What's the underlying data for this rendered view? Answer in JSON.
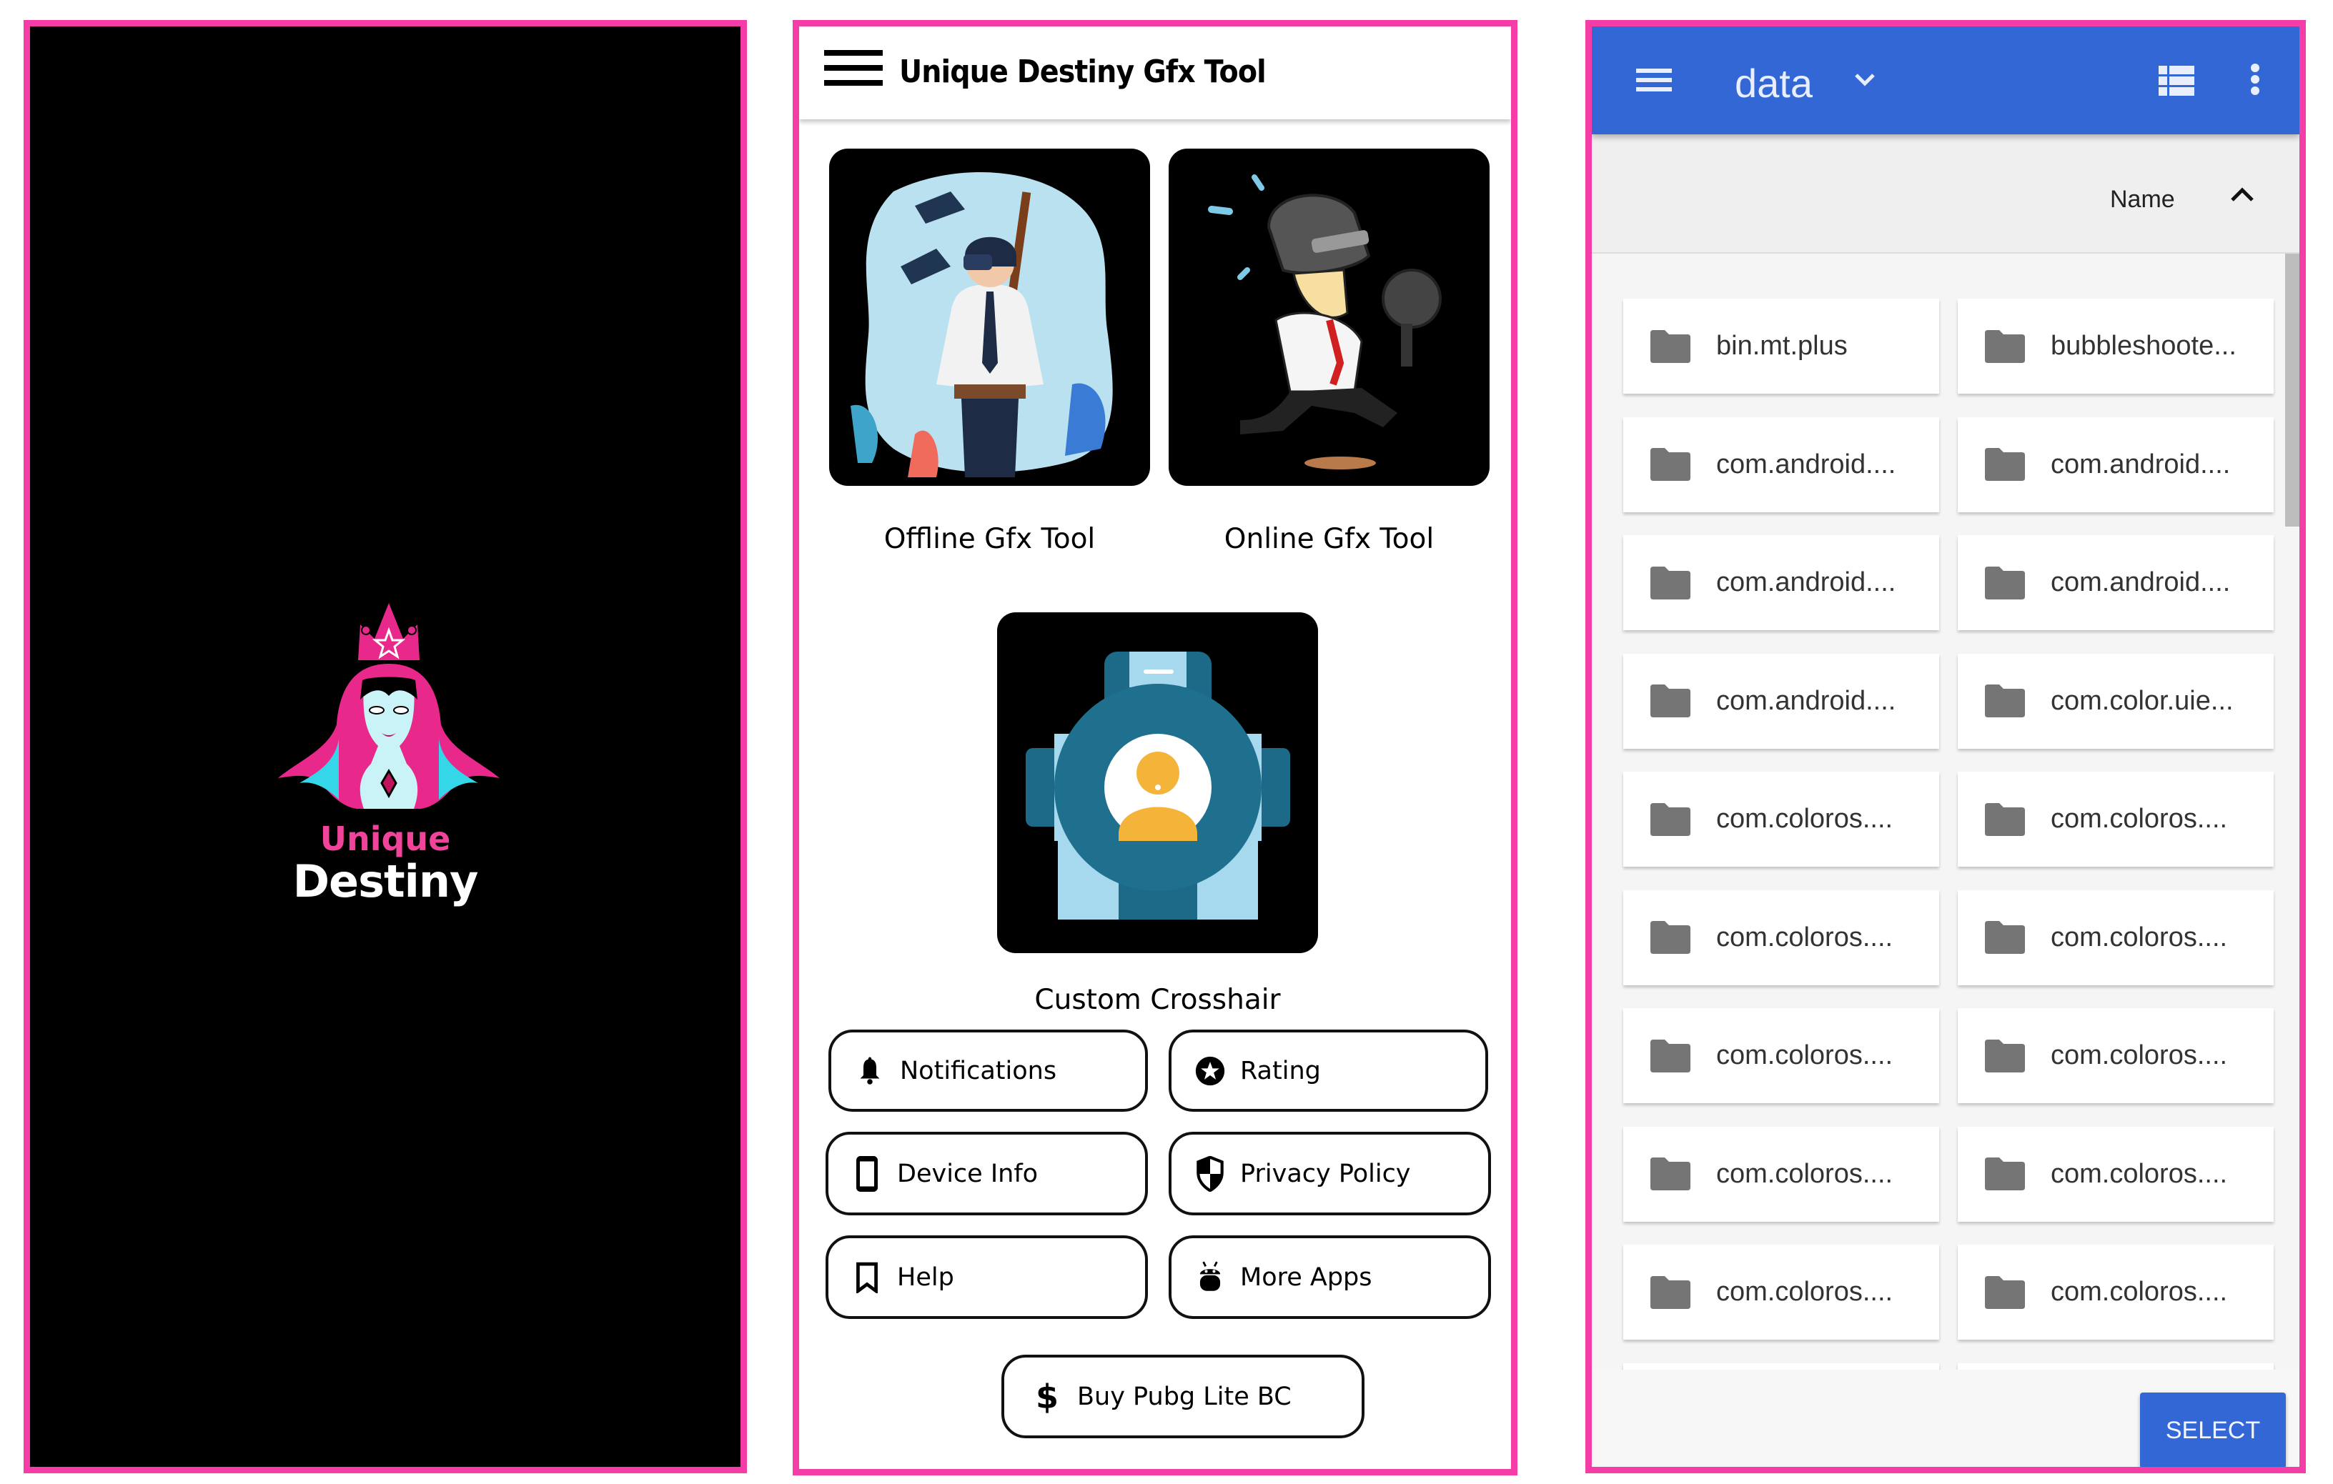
{
  "colors": {
    "frame_border": "#f53da8",
    "splash_bg": "#000000",
    "brand_pink": "#f0449b",
    "file_manager_accent": "#3367d6",
    "folder_icon": "#757575"
  },
  "splash": {
    "logo_icon": "queen-crown-logo",
    "brand_line1": "Unique",
    "brand_line2": "Destiny"
  },
  "app": {
    "menu_icon": "hamburger-menu-icon",
    "title": "Unique Destiny Gfx Tool",
    "tools": [
      {
        "label": "Offline Gfx Tool",
        "image": "pubg-player-illustration"
      },
      {
        "label": "Online Gfx Tool",
        "image": "running-helmet-frying-pan-illustration"
      },
      {
        "label": "Custom Crosshair",
        "image": "scope-crosshair-illustration"
      }
    ],
    "buttons": [
      {
        "label": "Notifications",
        "icon": "bell-icon"
      },
      {
        "label": "Rating",
        "icon": "star-circle-icon"
      },
      {
        "label": "Device Info",
        "icon": "phone-icon"
      },
      {
        "label": "Privacy Policy",
        "icon": "shield-icon"
      },
      {
        "label": "Help",
        "icon": "bookmark-icon"
      },
      {
        "label": "More Apps",
        "icon": "android-icon"
      }
    ],
    "buy_button": {
      "label": "Buy Pubg Lite BC",
      "icon": "dollar-icon"
    }
  },
  "file_picker": {
    "folder_title": "data",
    "dropdown_icon": "chevron-down-icon",
    "view_toggle_icon": "list-view-icon",
    "overflow_icon": "more-vert-icon",
    "sort": {
      "label": "Name",
      "direction": "ascending"
    },
    "folders": [
      "bin.mt.plus",
      "bubbleshoote...",
      "com.android....",
      "com.android....",
      "com.android....",
      "com.android....",
      "com.android....",
      "com.color.uie...",
      "com.coloros....",
      "com.coloros....",
      "com.coloros....",
      "com.coloros....",
      "com.coloros....",
      "com.coloros....",
      "com.coloros....",
      "com.coloros....",
      "com.coloros....",
      "com.coloros....",
      "",
      ""
    ],
    "select_label": "SELECT"
  }
}
